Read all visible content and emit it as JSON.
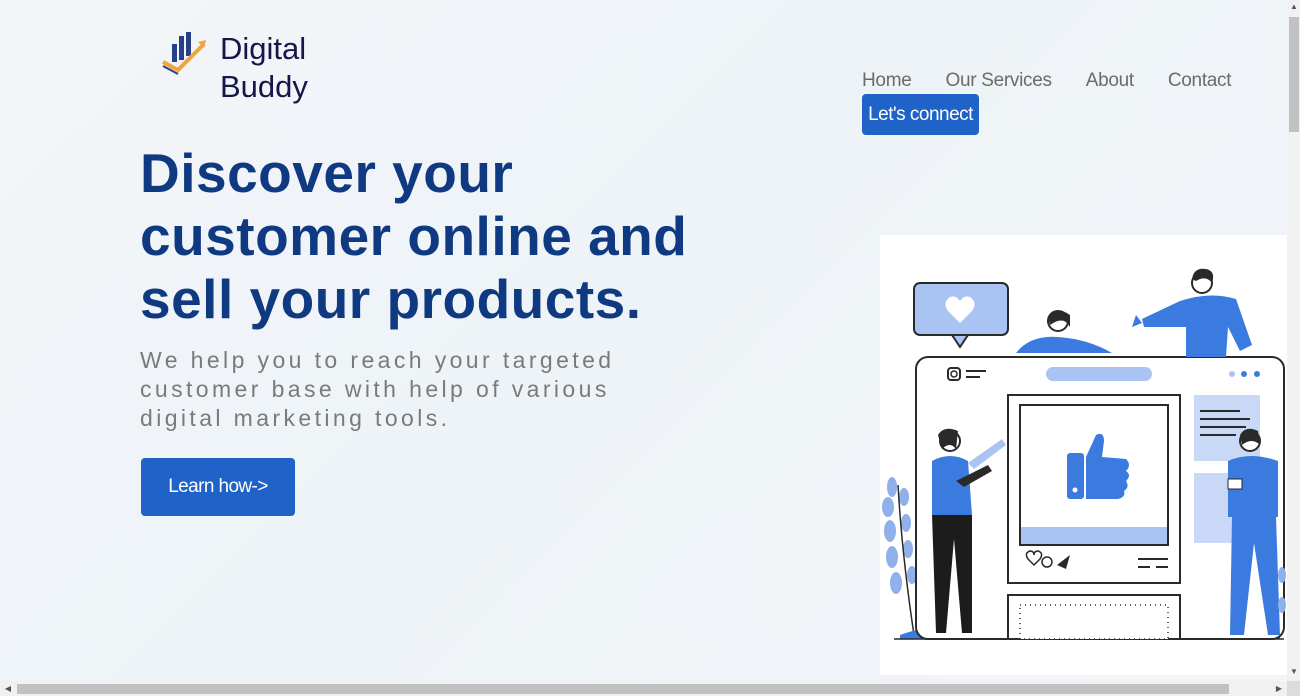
{
  "brand": {
    "line1": "Digital",
    "line2": "Buddy",
    "logo_icon": "bar-chart-arrow-icon"
  },
  "nav": {
    "links": [
      "Home",
      "Our Services",
      "About",
      "Contact"
    ],
    "cta": "Let's connect"
  },
  "hero": {
    "title": "Discover your customer online and sell your products.",
    "subtitle": "We help you to reach your targeted customer base with help of various digital marketing tools.",
    "button": "Learn how->"
  },
  "illustration": {
    "icon": "social-media-marketing-illustration"
  },
  "colors": {
    "primary": "#1f63c8",
    "heading": "#0f3a82",
    "brand_text": "#16164a",
    "accent_orange": "#f2a33a",
    "illus_blue": "#3b7be0"
  }
}
